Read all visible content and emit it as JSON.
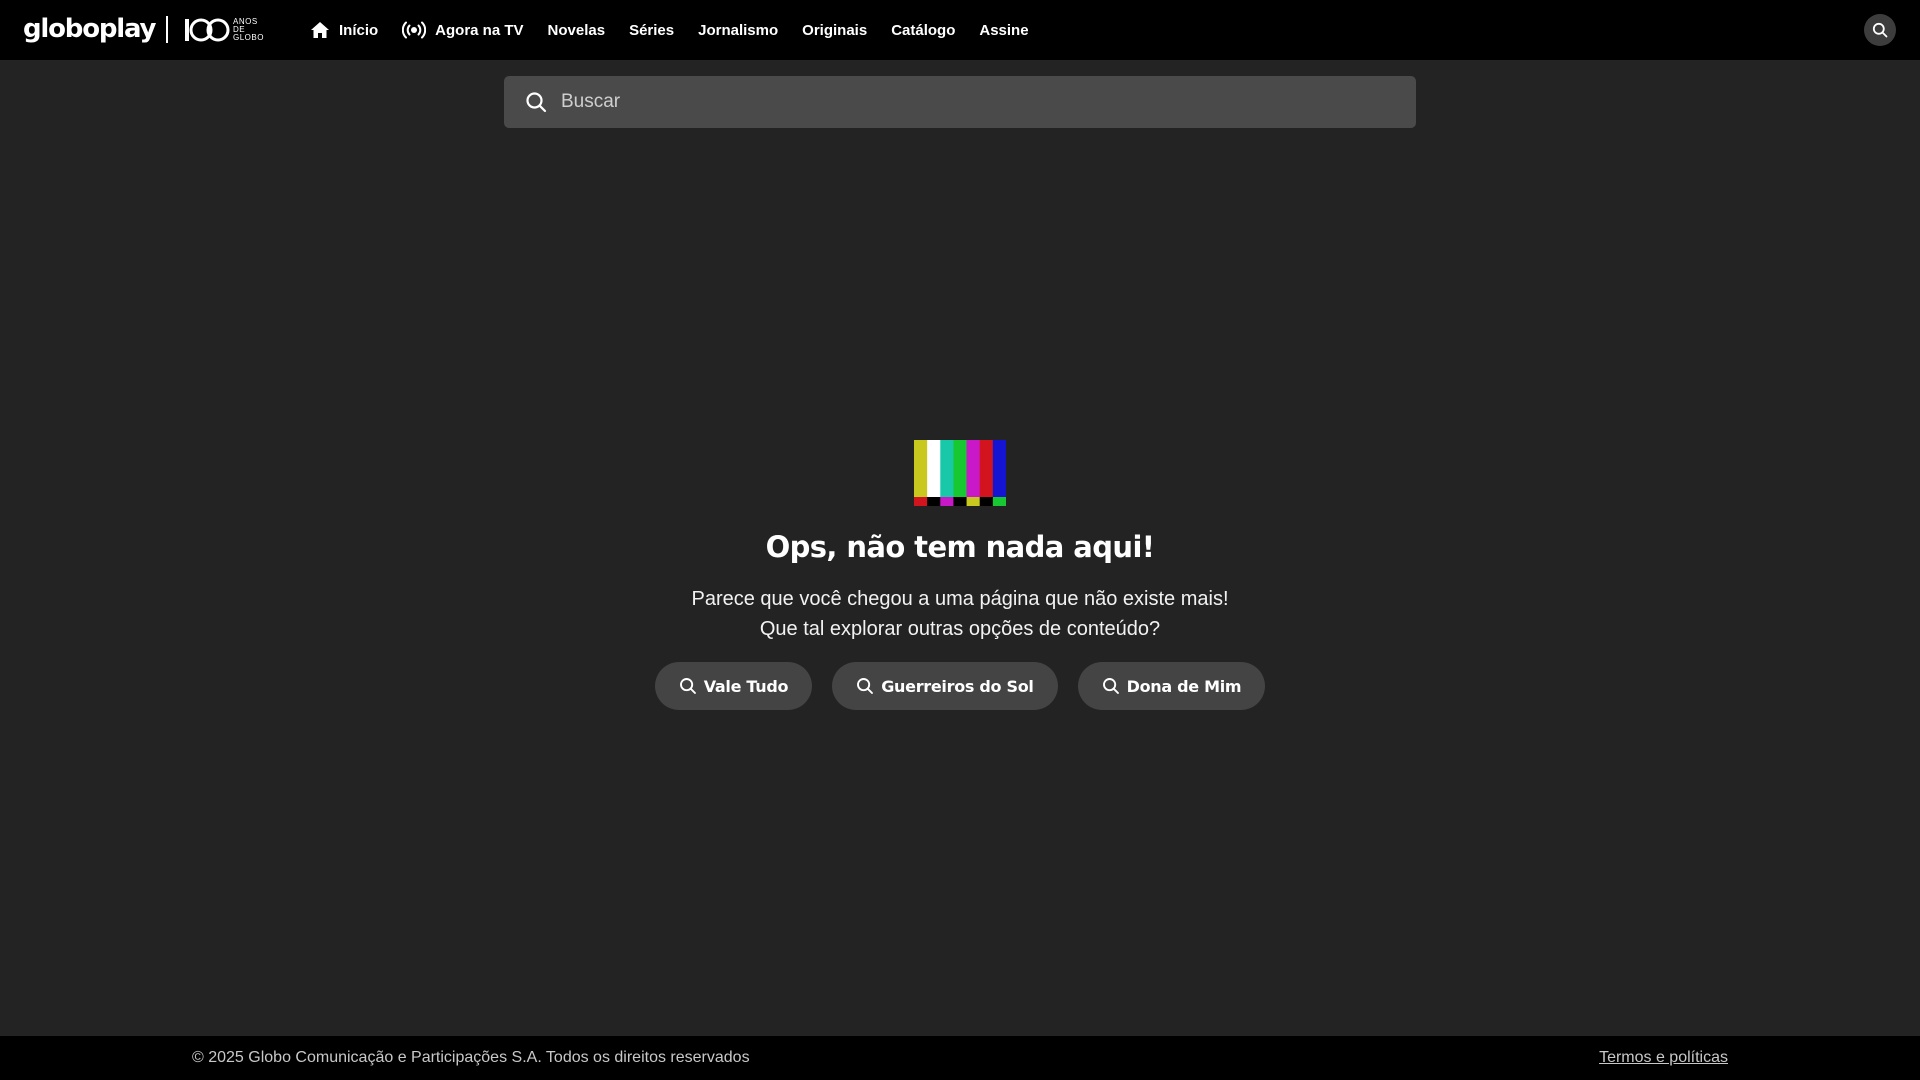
{
  "header": {
    "logo": "globoplay",
    "centenary_number": "100",
    "centenary_lines": [
      "ANOS",
      "DE",
      "GLOBO"
    ],
    "nav": [
      {
        "label": "Início",
        "icon": "home-icon"
      },
      {
        "label": "Agora na TV",
        "icon": "live-broadcast-icon"
      },
      {
        "label": "Novelas"
      },
      {
        "label": "Séries"
      },
      {
        "label": "Jornalismo"
      },
      {
        "label": "Originais"
      },
      {
        "label": "Catálogo"
      },
      {
        "label": "Assine"
      }
    ],
    "search_icon": "search-icon"
  },
  "search": {
    "placeholder": "Buscar",
    "value": ""
  },
  "empty_state": {
    "icon": "tv-color-bars-icon",
    "title": "Ops, não tem nada aqui!",
    "line1": "Parece que você chegou a uma página que não existe mais!",
    "line2": "Que tal explorar outras opções de conteúdo?",
    "suggestions": [
      "Vale Tudo",
      "Guerreiros do Sol",
      "Dona de Mim"
    ]
  },
  "footer": {
    "copyright": "© 2025 Globo Comunicação e Participações S.A. Todos os direitos reservados",
    "terms": "Termos e políticas"
  },
  "colors": {
    "background": "#232323",
    "topbar": "#000000",
    "search_field": "#4a4a4a",
    "pill": "#444444",
    "bars_top": [
      "#c8c81e",
      "#ffffff",
      "#18c8a8",
      "#18c832",
      "#c818c8",
      "#d2141e",
      "#1414d2"
    ],
    "bars_bottom": [
      "#d2141e",
      "#000000",
      "#c818c8",
      "#000000",
      "#c8c81e",
      "#000000",
      "#18c832"
    ]
  }
}
